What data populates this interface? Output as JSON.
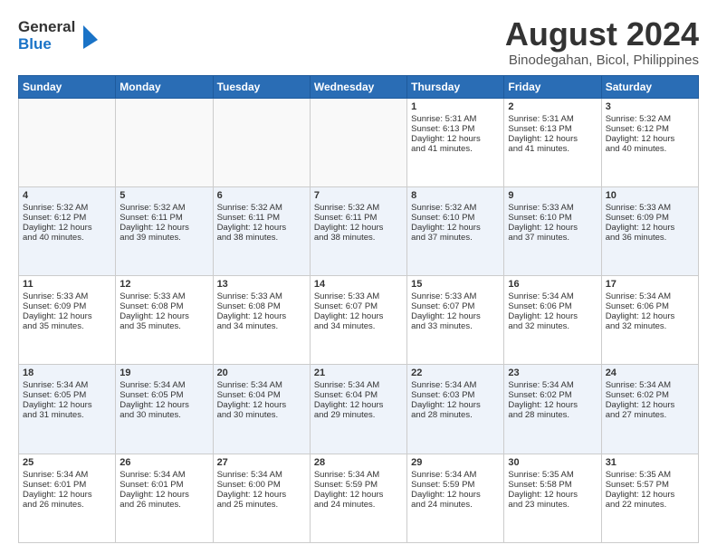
{
  "logo": {
    "line1": "General",
    "line2": "Blue"
  },
  "title": "August 2024",
  "subtitle": "Binodegahan, Bicol, Philippines",
  "days": [
    "Sunday",
    "Monday",
    "Tuesday",
    "Wednesday",
    "Thursday",
    "Friday",
    "Saturday"
  ],
  "weeks": [
    [
      {
        "num": "",
        "info": ""
      },
      {
        "num": "",
        "info": ""
      },
      {
        "num": "",
        "info": ""
      },
      {
        "num": "",
        "info": ""
      },
      {
        "num": "1",
        "info": "Sunrise: 5:31 AM\nSunset: 6:13 PM\nDaylight: 12 hours\nand 41 minutes."
      },
      {
        "num": "2",
        "info": "Sunrise: 5:31 AM\nSunset: 6:13 PM\nDaylight: 12 hours\nand 41 minutes."
      },
      {
        "num": "3",
        "info": "Sunrise: 5:32 AM\nSunset: 6:12 PM\nDaylight: 12 hours\nand 40 minutes."
      }
    ],
    [
      {
        "num": "4",
        "info": "Sunrise: 5:32 AM\nSunset: 6:12 PM\nDaylight: 12 hours\nand 40 minutes."
      },
      {
        "num": "5",
        "info": "Sunrise: 5:32 AM\nSunset: 6:11 PM\nDaylight: 12 hours\nand 39 minutes."
      },
      {
        "num": "6",
        "info": "Sunrise: 5:32 AM\nSunset: 6:11 PM\nDaylight: 12 hours\nand 38 minutes."
      },
      {
        "num": "7",
        "info": "Sunrise: 5:32 AM\nSunset: 6:11 PM\nDaylight: 12 hours\nand 38 minutes."
      },
      {
        "num": "8",
        "info": "Sunrise: 5:32 AM\nSunset: 6:10 PM\nDaylight: 12 hours\nand 37 minutes."
      },
      {
        "num": "9",
        "info": "Sunrise: 5:33 AM\nSunset: 6:10 PM\nDaylight: 12 hours\nand 37 minutes."
      },
      {
        "num": "10",
        "info": "Sunrise: 5:33 AM\nSunset: 6:09 PM\nDaylight: 12 hours\nand 36 minutes."
      }
    ],
    [
      {
        "num": "11",
        "info": "Sunrise: 5:33 AM\nSunset: 6:09 PM\nDaylight: 12 hours\nand 35 minutes."
      },
      {
        "num": "12",
        "info": "Sunrise: 5:33 AM\nSunset: 6:08 PM\nDaylight: 12 hours\nand 35 minutes."
      },
      {
        "num": "13",
        "info": "Sunrise: 5:33 AM\nSunset: 6:08 PM\nDaylight: 12 hours\nand 34 minutes."
      },
      {
        "num": "14",
        "info": "Sunrise: 5:33 AM\nSunset: 6:07 PM\nDaylight: 12 hours\nand 34 minutes."
      },
      {
        "num": "15",
        "info": "Sunrise: 5:33 AM\nSunset: 6:07 PM\nDaylight: 12 hours\nand 33 minutes."
      },
      {
        "num": "16",
        "info": "Sunrise: 5:34 AM\nSunset: 6:06 PM\nDaylight: 12 hours\nand 32 minutes."
      },
      {
        "num": "17",
        "info": "Sunrise: 5:34 AM\nSunset: 6:06 PM\nDaylight: 12 hours\nand 32 minutes."
      }
    ],
    [
      {
        "num": "18",
        "info": "Sunrise: 5:34 AM\nSunset: 6:05 PM\nDaylight: 12 hours\nand 31 minutes."
      },
      {
        "num": "19",
        "info": "Sunrise: 5:34 AM\nSunset: 6:05 PM\nDaylight: 12 hours\nand 30 minutes."
      },
      {
        "num": "20",
        "info": "Sunrise: 5:34 AM\nSunset: 6:04 PM\nDaylight: 12 hours\nand 30 minutes."
      },
      {
        "num": "21",
        "info": "Sunrise: 5:34 AM\nSunset: 6:04 PM\nDaylight: 12 hours\nand 29 minutes."
      },
      {
        "num": "22",
        "info": "Sunrise: 5:34 AM\nSunset: 6:03 PM\nDaylight: 12 hours\nand 28 minutes."
      },
      {
        "num": "23",
        "info": "Sunrise: 5:34 AM\nSunset: 6:02 PM\nDaylight: 12 hours\nand 28 minutes."
      },
      {
        "num": "24",
        "info": "Sunrise: 5:34 AM\nSunset: 6:02 PM\nDaylight: 12 hours\nand 27 minutes."
      }
    ],
    [
      {
        "num": "25",
        "info": "Sunrise: 5:34 AM\nSunset: 6:01 PM\nDaylight: 12 hours\nand 26 minutes."
      },
      {
        "num": "26",
        "info": "Sunrise: 5:34 AM\nSunset: 6:01 PM\nDaylight: 12 hours\nand 26 minutes."
      },
      {
        "num": "27",
        "info": "Sunrise: 5:34 AM\nSunset: 6:00 PM\nDaylight: 12 hours\nand 25 minutes."
      },
      {
        "num": "28",
        "info": "Sunrise: 5:34 AM\nSunset: 5:59 PM\nDaylight: 12 hours\nand 24 minutes."
      },
      {
        "num": "29",
        "info": "Sunrise: 5:34 AM\nSunset: 5:59 PM\nDaylight: 12 hours\nand 24 minutes."
      },
      {
        "num": "30",
        "info": "Sunrise: 5:35 AM\nSunset: 5:58 PM\nDaylight: 12 hours\nand 23 minutes."
      },
      {
        "num": "31",
        "info": "Sunrise: 5:35 AM\nSunset: 5:57 PM\nDaylight: 12 hours\nand 22 minutes."
      }
    ]
  ]
}
